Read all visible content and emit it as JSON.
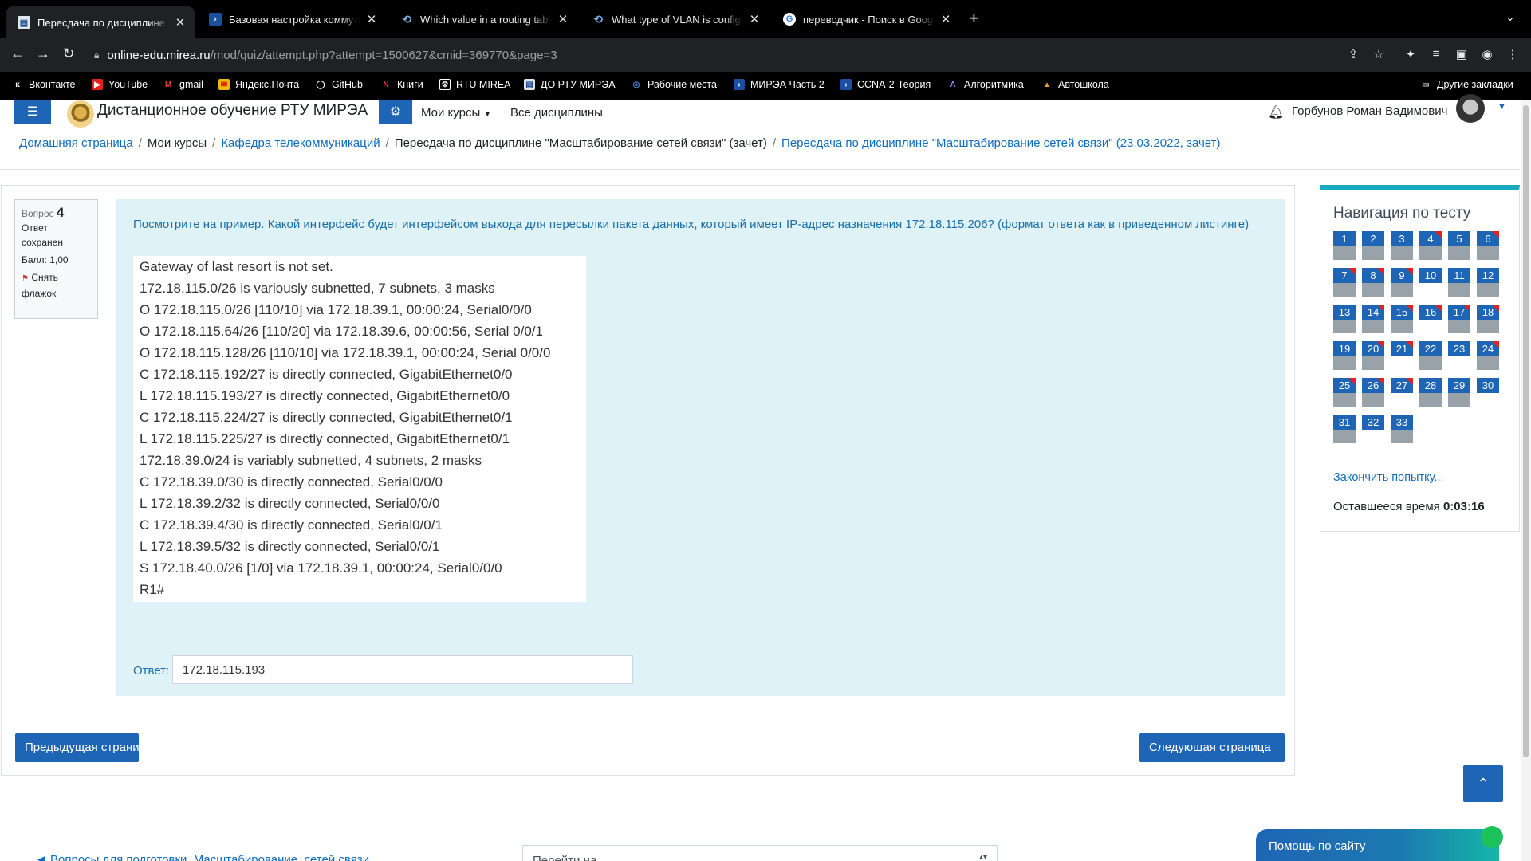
{
  "browser": {
    "tabs": [
      {
        "title": "Пересдача по дисциплине \"Масштабирование сетей связи\"",
        "favicon": "moodle-doc-icon",
        "active": true
      },
      {
        "title": "Базовая настройка коммутатора",
        "favicon": "mirea-arrow-icon",
        "active": false
      },
      {
        "title": "Which value in a routing table represents",
        "favicon": "link-icon",
        "active": false
      },
      {
        "title": "What type of VLAN is configured",
        "favicon": "link-icon",
        "active": false
      },
      {
        "title": "переводчик - Поиск в Google",
        "favicon": "google-icon",
        "active": false
      }
    ],
    "new_tab": "+",
    "url_host": "online-edu.mirea.ru",
    "url_path": "/mod/quiz/attempt.php?attempt=1500627&cmid=369770&page=3",
    "bookmarks": [
      "Вконтакте",
      "YouTube",
      "gmail",
      "Яндекс.Почта",
      "GitHub",
      "Книги",
      "RTU MIREA",
      "ДО РТУ МИРЭА",
      "Рабочие места",
      "МИРЭА Часть 2",
      "CCNA-2-Теория",
      "Алгоритмика",
      "Автошкола"
    ],
    "other_bookmarks": "Другие закладки"
  },
  "header": {
    "site_name": "Дистанционное обучение РТУ МИРЭА",
    "my_courses": "Мои курсы",
    "all_disciplines": "Все дисциплины",
    "user_name": "Горбунов Роман Вадимович"
  },
  "breadcrumb": {
    "home": "Домашняя страница",
    "my_courses": "Мои курсы",
    "department": "Кафедра телекоммуникаций",
    "course": "Пересдача по дисциплине \"Масштабирование сетей связи\" (зачет)",
    "quiz": "Пересдача по дисциплине \"Масштабирование сетей связи\" (23.03.2022, зачет)"
  },
  "question": {
    "label": "Вопрос",
    "number": "4",
    "state": "Ответ сохранен",
    "grade": "Балл: 1,00",
    "flag": "Снять флажок",
    "text": "Посмотрите на пример. Какой интерфейс будет интерфейсом выхода для пересылки пакета данных, который имеет IP-адрес назначения 172.18.115.206? (формат ответа как в приведенном листинге)",
    "listing": [
      "Gateway of last resort is not set.",
      "172.18.115.0/26 is variously subnetted, 7 subnets, 3 masks",
      "O 172.18.115.0/26 [110/10] via 172.18.39.1, 00:00:24, Serial0/0/0",
      "O 172.18.115.64/26 [110/20] via 172.18.39.6, 00:00:56, Serial 0/0/1",
      "O 172.18.115.128/26 [110/10] via 172.18.39.1, 00:00:24, Serial 0/0/0",
      "C 172.18.115.192/27 is directly connected, GigabitEthernet0/0",
      "L 172.18.115.193/27 is directly connected, GigabitEthernet0/0",
      "C 172.18.115.224/27 is directly connected, GigabitEthernet0/1",
      "L 172.18.115.225/27 is directly connected, GigabitEthernet0/1",
      "172.18.39.0/24 is variably subnetted, 4 subnets, 2 masks",
      "C 172.18.39.0/30 is directly connected, Serial0/0/0",
      "L 172.18.39.2/32 is directly connected, Serial0/0/0",
      "C 172.18.39.4/30 is directly connected, Serial0/0/1",
      "L 172.18.39.5/32 is directly connected, Serial0/0/1",
      "S 172.18.40.0/26 [1/0] via 172.18.39.1, 00:00:24, Serial0/0/0",
      "R1#"
    ],
    "answer_label": "Ответ:",
    "answer_value": "172.18.115.193"
  },
  "buttons": {
    "prev": "Предыдущая страница",
    "next": "Следующая страница"
  },
  "quiz_nav": {
    "title": "Навигация по тесту",
    "questions": [
      {
        "n": "1",
        "flagged": false,
        "answered": true
      },
      {
        "n": "2",
        "flagged": false,
        "answered": true
      },
      {
        "n": "3",
        "flagged": false,
        "answered": true
      },
      {
        "n": "4",
        "flagged": true,
        "answered": true,
        "current": true
      },
      {
        "n": "5",
        "flagged": false,
        "answered": true
      },
      {
        "n": "6",
        "flagged": true,
        "answered": true
      },
      {
        "n": "7",
        "flagged": true,
        "answered": true
      },
      {
        "n": "8",
        "flagged": true,
        "answered": true
      },
      {
        "n": "9",
        "flagged": true,
        "answered": true
      },
      {
        "n": "10",
        "flagged": false,
        "answered": false
      },
      {
        "n": "11",
        "flagged": false,
        "answered": true
      },
      {
        "n": "12",
        "flagged": false,
        "answered": true
      },
      {
        "n": "13",
        "flagged": false,
        "answered": true
      },
      {
        "n": "14",
        "flagged": true,
        "answered": true
      },
      {
        "n": "15",
        "flagged": true,
        "answered": true
      },
      {
        "n": "16",
        "flagged": true,
        "answered": false
      },
      {
        "n": "17",
        "flagged": true,
        "answered": true
      },
      {
        "n": "18",
        "flagged": true,
        "answered": true
      },
      {
        "n": "19",
        "flagged": false,
        "answered": true
      },
      {
        "n": "20",
        "flagged": true,
        "answered": true
      },
      {
        "n": "21",
        "flagged": true,
        "answered": false
      },
      {
        "n": "22",
        "flagged": false,
        "answered": true
      },
      {
        "n": "23",
        "flagged": false,
        "answered": false
      },
      {
        "n": "24",
        "flagged": true,
        "answered": true
      },
      {
        "n": "25",
        "flagged": true,
        "answered": true
      },
      {
        "n": "26",
        "flagged": true,
        "answered": true
      },
      {
        "n": "27",
        "flagged": true,
        "answered": false
      },
      {
        "n": "28",
        "flagged": false,
        "answered": true
      },
      {
        "n": "29",
        "flagged": false,
        "answered": true
      },
      {
        "n": "30",
        "flagged": false,
        "answered": false
      },
      {
        "n": "31",
        "flagged": false,
        "answered": true
      },
      {
        "n": "32",
        "flagged": false,
        "answered": false
      },
      {
        "n": "33",
        "flagged": false,
        "answered": true
      }
    ],
    "finish": "Закончить попытку...",
    "time_label": "Оставшееся время",
    "time_value": "0:03:16"
  },
  "footer": {
    "prev_activity": "◄ Вопросы для подготовки. Масштабирование. сетей связи",
    "jump_to": "Перейти на...",
    "help": "Помощь по сайту"
  },
  "colors": {
    "primary": "#1f65b5",
    "question_bg": "#def2f8",
    "flag": "#e52222",
    "nav_accent": "#15aabf"
  }
}
